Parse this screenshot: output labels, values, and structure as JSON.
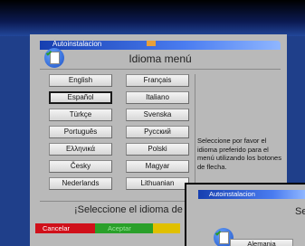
{
  "window": {
    "header": "Autoinstalacion",
    "title": "Idioma menú"
  },
  "languages": [
    "English",
    "Français",
    "Español",
    "Italiano",
    "Türkçe",
    "Svenska",
    "Português",
    "Русский",
    "Ελληνικά",
    "Polski",
    "Česky",
    "Magyar",
    "Nederlands",
    "Lithuanian"
  ],
  "selected_language": "Español",
  "help_text": "Seleccione por favor el idioma preferido para el menú utilizando los botones de flecha.",
  "prompt": "¡Seleccione el idioma de",
  "buttons": {
    "red": "Cancelar",
    "green": "Aceptar"
  },
  "overlay_window": {
    "header": "Autoinstalacion",
    "title": "Se",
    "first_item": "Alemania"
  },
  "colors": {
    "red_button": "#d0101a",
    "green_button": "#2aa02a",
    "yellow_button": "#e0c000",
    "title_bar": "#163fb0"
  }
}
